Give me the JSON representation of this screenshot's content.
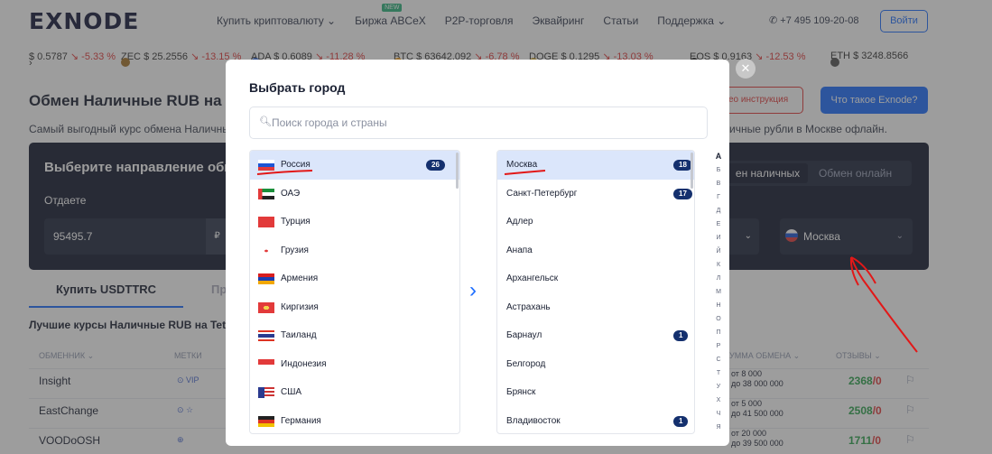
{
  "header": {
    "logo": "EXNODE",
    "nav": [
      {
        "label": "Купить криптовалюту",
        "chevron": true
      },
      {
        "label": "Биржа ABCeX",
        "badge": "NEW"
      },
      {
        "label": "P2P-торговля"
      },
      {
        "label": "Эквайринг"
      },
      {
        "label": "Статьи"
      },
      {
        "label": "Поддержка",
        "chevron": true
      }
    ],
    "phone": "+7 495 109-20-08",
    "login": "Войти"
  },
  "ticker": [
    {
      "name": "",
      "price": "$ 0.5787",
      "change": "↘ -5.33 %"
    },
    {
      "name": "ZEC",
      "price": "$ 25.2556",
      "change": "↘ -13.15 %"
    },
    {
      "name": "ADA",
      "price": "$ 0.6089",
      "change": "↘ -11.28 %"
    },
    {
      "name": "BTC",
      "price": "$ 63642.092",
      "change": "↘ -6.78 %"
    },
    {
      "name": "DOGE",
      "price": "$ 0.1295",
      "change": "↘ -13.03 %"
    },
    {
      "name": "EOS",
      "price": "$ 0.9163",
      "change": "↘ -12.53 %"
    },
    {
      "name": "ETH",
      "price": "$ 3248.8566",
      "change": ""
    }
  ],
  "page": {
    "title": "Обмен Наличные RUB на Т",
    "subtitle_left": "Самый выгодный курс обмена Наличные",
    "subtitle_right": "ичные рубли в Москве офлайн.",
    "instruction_btn": "ео инструкция",
    "what_btn": "Что такое Exnode?"
  },
  "panel": {
    "heading": "Выберите направление обме",
    "give_label": "Отдаете",
    "give_value": "95495.7",
    "mode_active": "ен наличных",
    "mode_other": "Обмен онлайн",
    "city": "Москва"
  },
  "tabs": {
    "buy": "Купить USDTTRC",
    "sell": "Пр"
  },
  "table": {
    "best_title": "Лучшие курсы Наличные RUB на Tether",
    "headers": {
      "exchanger": "ОБМЕННИК ⌄",
      "tags": "МЕТКИ",
      "amount": "УММА ОБМЕНА ⌄",
      "reviews": "ОТЗЫВЫ ⌄"
    },
    "rows": [
      {
        "name": "Insight",
        "tags": "⊙ VIP",
        "from": "от 8 000",
        "to": "до 38 000 000",
        "reviews": "2368",
        "neg": "0"
      },
      {
        "name": "EastChange",
        "tags": "⊙ ☆",
        "from": "от 5 000",
        "to": "до 41 500 000",
        "reviews": "2508",
        "neg": "0"
      },
      {
        "name": "VOODoOSH",
        "tags": "⊕",
        "from": "от 20 000",
        "to": "до 39 500 000",
        "reviews": "1711",
        "neg": "0"
      }
    ],
    "sep": "/"
  },
  "modal": {
    "title": "Выбрать город",
    "search_placeholder": "Поиск города и страны",
    "countries": [
      {
        "name": "Россия",
        "count": "26",
        "selected": true
      },
      {
        "name": "ОАЭ"
      },
      {
        "name": "Турция"
      },
      {
        "name": "Грузия"
      },
      {
        "name": "Армения"
      },
      {
        "name": "Киргизия"
      },
      {
        "name": "Таиланд"
      },
      {
        "name": "Индонезия"
      },
      {
        "name": "США"
      },
      {
        "name": "Германия"
      }
    ],
    "cities": [
      {
        "name": "Москва",
        "count": "18",
        "selected": true
      },
      {
        "name": "Санкт-Петербург",
        "count": "17"
      },
      {
        "name": "Адлер"
      },
      {
        "name": "Анапа"
      },
      {
        "name": "Архангельск"
      },
      {
        "name": "Астрахань"
      },
      {
        "name": "Барнаул",
        "count": "1"
      },
      {
        "name": "Белгород"
      },
      {
        "name": "Брянск"
      },
      {
        "name": "Владивосток",
        "count": "1"
      }
    ],
    "alphabet": [
      "А",
      "Б",
      "В",
      "Г",
      "Д",
      "Е",
      "И",
      "Й",
      "К",
      "Л",
      "М",
      "Н",
      "О",
      "П",
      "Р",
      "С",
      "Т",
      "У",
      "Х",
      "Ч",
      "Я"
    ]
  },
  "colors": {
    "accent": "#1f6fff",
    "danger": "#e23a3a",
    "positive": "#2fa44f",
    "dark_panel": "#141a30"
  }
}
